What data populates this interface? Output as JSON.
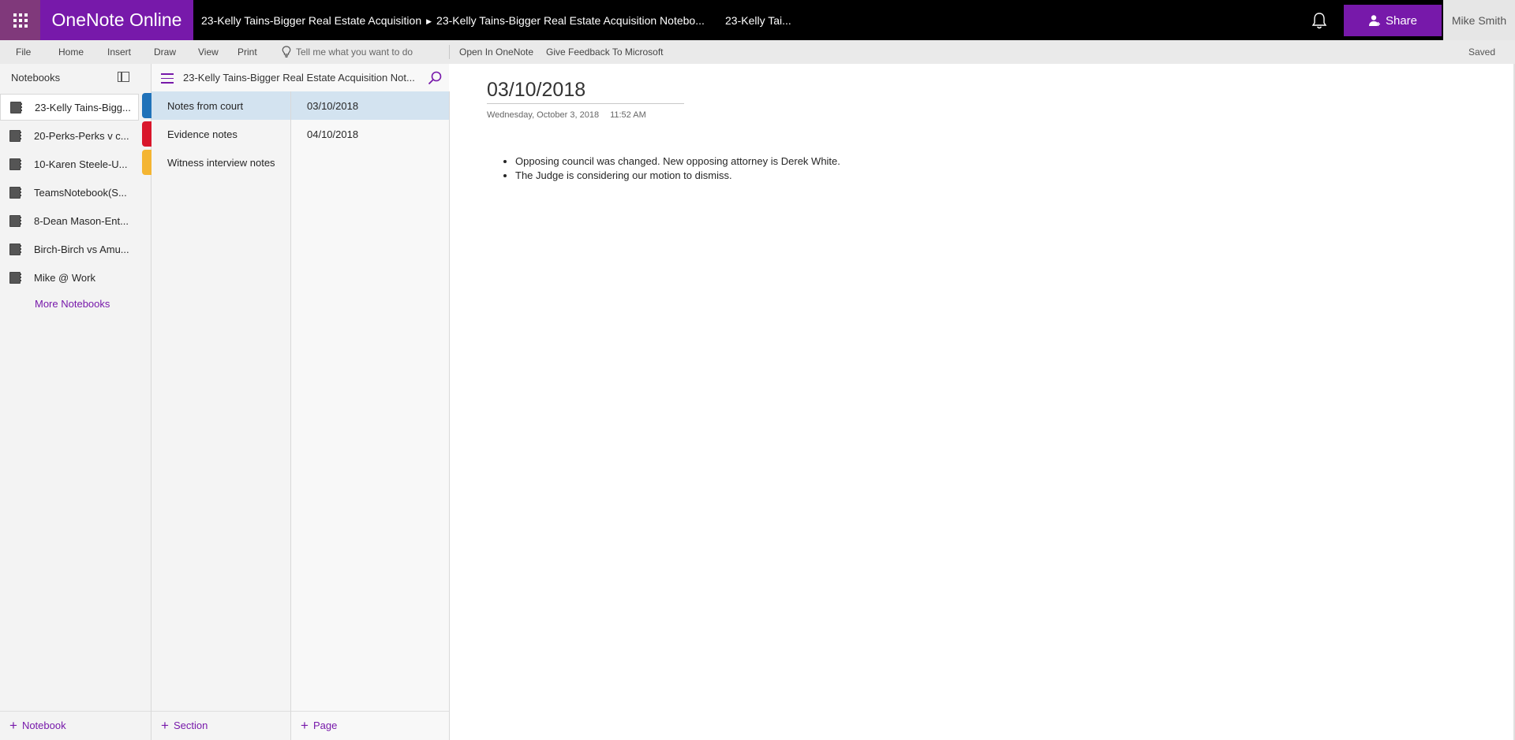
{
  "app": {
    "name": "OneNote Online"
  },
  "header": {
    "breadcrumb": [
      "23-Kelly Tains-Bigger Real Estate Acquisition",
      "23-Kelly Tains-Bigger Real Estate Acquisition Notebo..."
    ],
    "breadcrumb_extra": "23-Kelly Tai...",
    "share_label": "Share",
    "user_name": "Mike Smith"
  },
  "ribbon": {
    "tabs": [
      "File",
      "Home",
      "Insert",
      "Draw",
      "View",
      "Print"
    ],
    "tell_me": "Tell me what you want to do",
    "open_in_onenote": "Open In OneNote",
    "feedback": "Give Feedback To Microsoft",
    "status": "Saved"
  },
  "notebooks": {
    "header": "Notebooks",
    "items": [
      "23-Kelly Tains-Bigg...",
      "20-Perks-Perks v c...",
      "10-Karen Steele-U...",
      "TeamsNotebook(S...",
      "8-Dean Mason-Ent...",
      "Birch-Birch vs Amu...",
      "Mike @ Work"
    ],
    "more": "More Notebooks",
    "add_label": "Notebook"
  },
  "sections": {
    "notebook_title": "23-Kelly Tains-Bigger Real Estate Acquisition Not...",
    "items": [
      {
        "label": "Notes from court",
        "color": "#2072b9"
      },
      {
        "label": "Evidence notes",
        "color": "#d9162b"
      },
      {
        "label": "Witness interview notes",
        "color": "#f4b532"
      }
    ],
    "add_label": "Section"
  },
  "pages": {
    "items": [
      "03/10/2018",
      "04/10/2018"
    ],
    "add_label": "Page"
  },
  "page": {
    "title": "03/10/2018",
    "date": "Wednesday, October 3, 2018",
    "time": "11:52 AM",
    "notes": [
      "Opposing council was changed. New opposing attorney is Derek White.",
      "The Judge is considering our motion to dismiss."
    ]
  },
  "colors": {
    "brand_purple": "#7719aa",
    "waffle_bg": "#80397b",
    "selected_bg": "#d3e3f0"
  }
}
